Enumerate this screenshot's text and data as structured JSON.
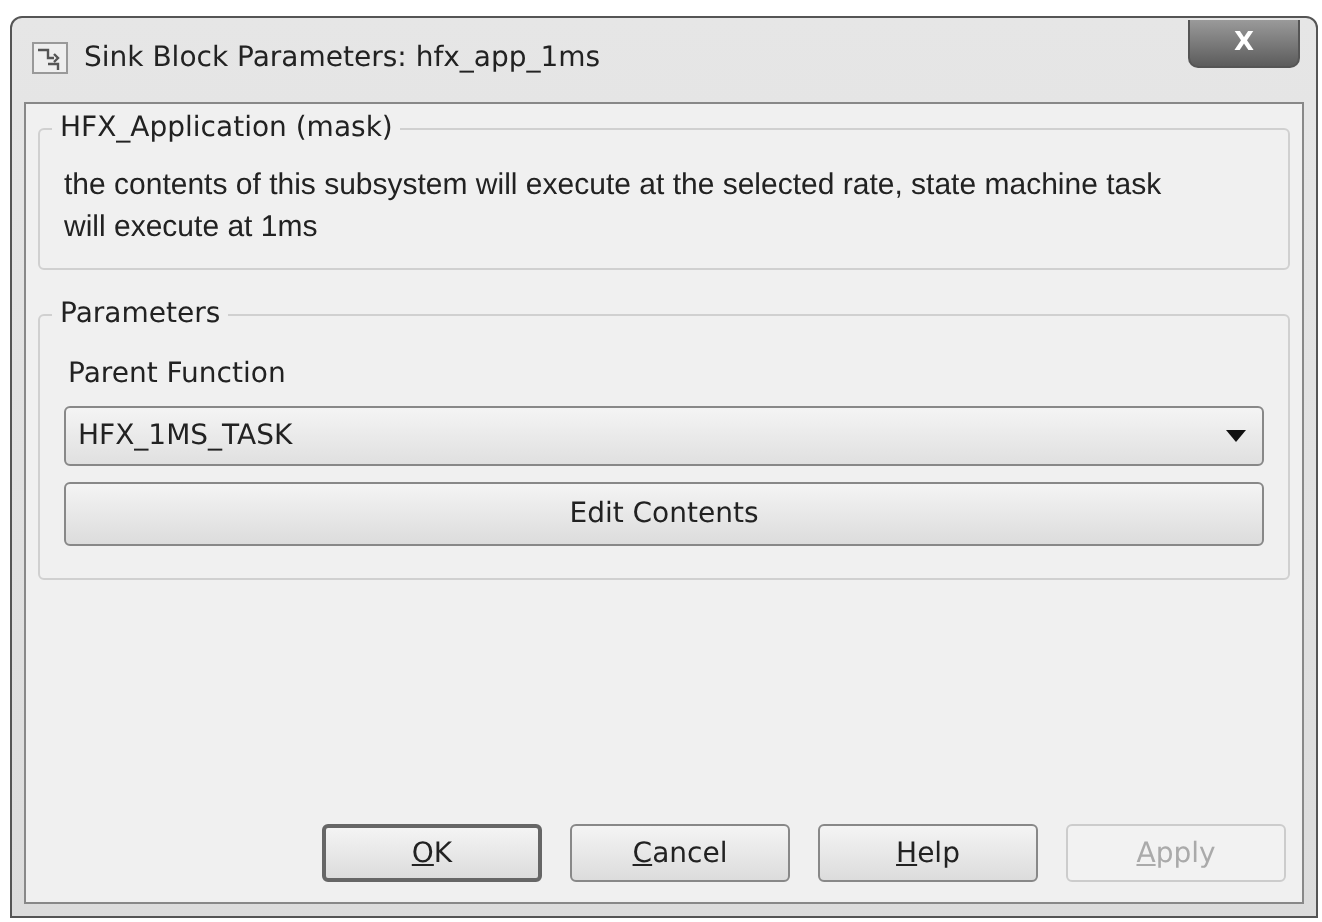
{
  "window": {
    "title": "Sink Block Parameters: hfx_app_1ms",
    "close": "X"
  },
  "mask_group": {
    "title": "HFX_Application (mask)",
    "description": "the contents of this subsystem will execute at the selected rate, state machine task will execute at 1ms"
  },
  "parameters_group": {
    "title": "Parameters",
    "field_label": "Parent Function",
    "dropdown": {
      "value": "HFX_1MS_TASK"
    },
    "edit_button": "Edit Contents"
  },
  "buttons": [
    {
      "key": "O",
      "rest": "K",
      "default": true,
      "disabled": false
    },
    {
      "key": "C",
      "rest": "ancel",
      "default": false,
      "disabled": false
    },
    {
      "key": "H",
      "rest": "elp",
      "default": false,
      "disabled": false
    },
    {
      "key": "A",
      "rest": "pply",
      "default": false,
      "disabled": true
    }
  ]
}
